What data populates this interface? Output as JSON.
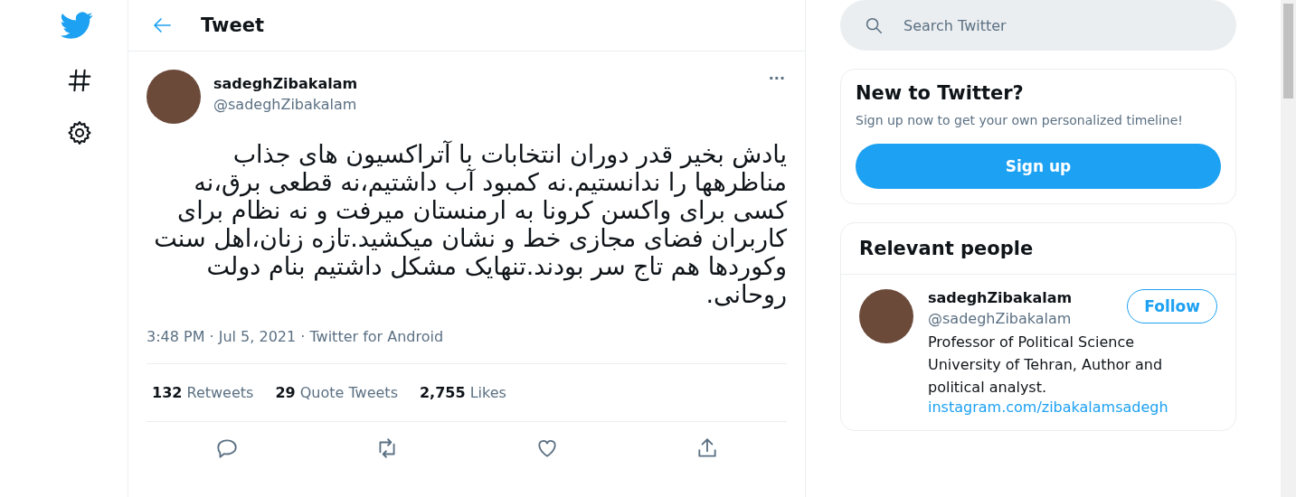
{
  "header": {
    "title": "Tweet"
  },
  "tweet": {
    "name": "sadeghZibakalam",
    "handle": "@sadeghZibakalam",
    "more": "···",
    "text": "یادش بخیر قدر دوران انتخابات با آتراکسیون های جذاب مناظرهها را ندانستیم.نه کمبود آب داشتیم،نه قطعی برق،نه کسی برای واکسن کرونا به ارمنستان میرفت و نه نظام برای کاربران فضای مجازی خط و نشان میکشید.تازه زنان،اهل سنت وکوردها هم تاج سر بودند.تنهایک مشکل داشتیم بنام دولت روحانی.",
    "meta": "3:48 PM · Jul 5, 2021 · Twitter for Android",
    "stats": [
      "**132** Retweets",
      "**29** Quote Tweets",
      "**2,755** Likes"
    ]
  },
  "search": {
    "placeholder": "Search Twitter"
  },
  "signup_card": {
    "title": "New to Twitter?",
    "subtitle": "Sign up now to get your own personalized timeline!",
    "button": "Sign up"
  },
  "relevant": {
    "title": "Relevant people",
    "people": [
      {
        "name": "sadeghZibakalam",
        "handle": "@sadeghZibakalam",
        "button": "Follow",
        "bio": "Professor of Political Science University of Tehran, Author and political analyst.",
        "link": "instagram.com/zibakalamsadegh"
      }
    ]
  }
}
